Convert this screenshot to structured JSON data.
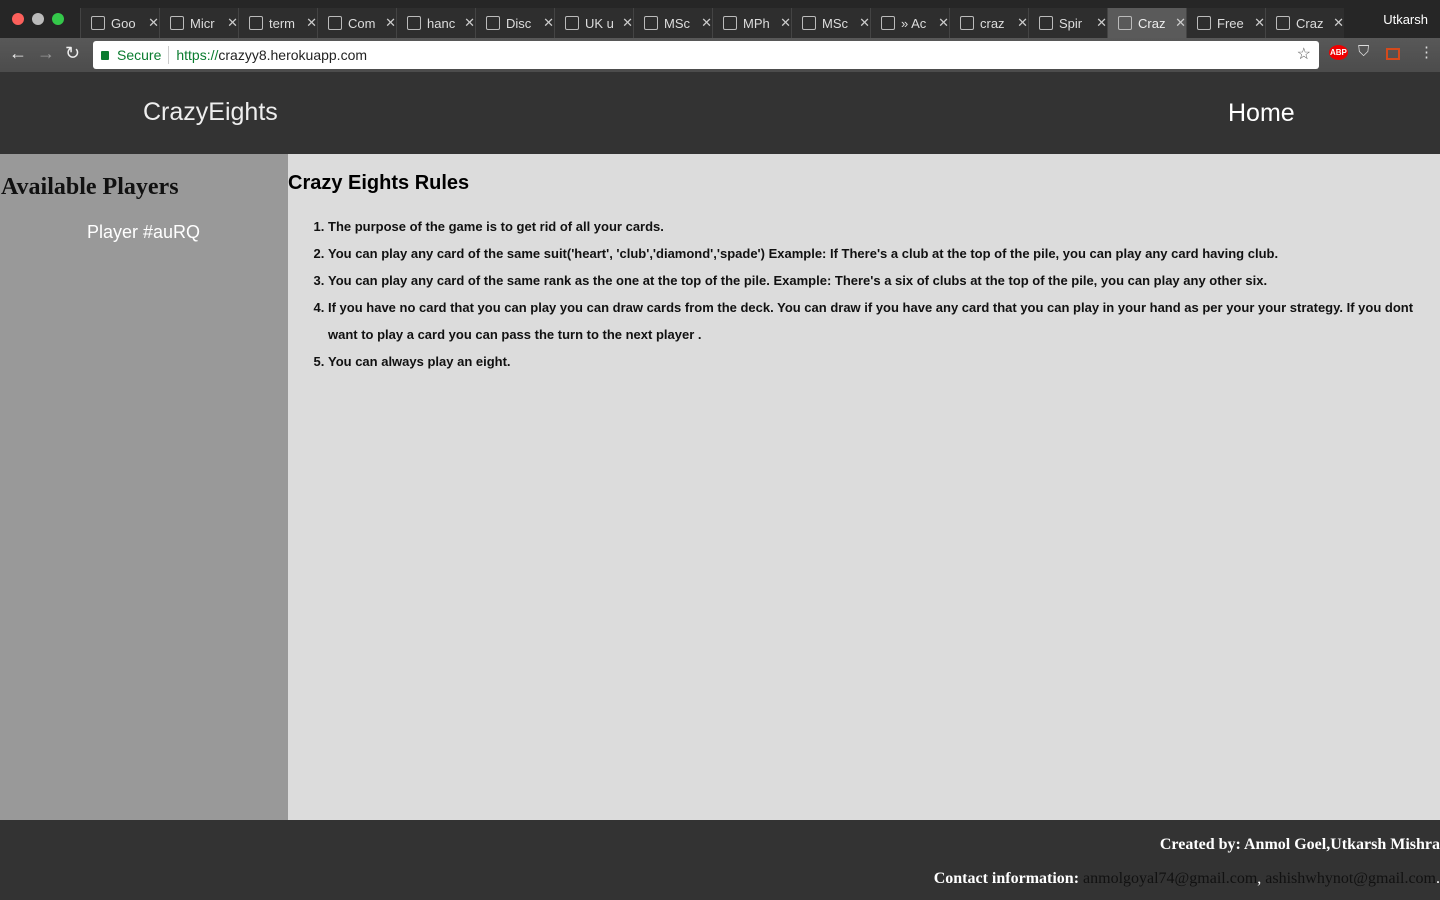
{
  "browser": {
    "tabs": [
      {
        "label": "Goo"
      },
      {
        "label": "Micr"
      },
      {
        "label": "term"
      },
      {
        "label": "Com"
      },
      {
        "label": "hanc"
      },
      {
        "label": "Disc"
      },
      {
        "label": "UK u"
      },
      {
        "label": "MSc"
      },
      {
        "label": "MPh"
      },
      {
        "label": "MSc"
      },
      {
        "label": "» Ac"
      },
      {
        "label": "craz"
      },
      {
        "label": "Spir"
      },
      {
        "label": "Craz",
        "active": true
      },
      {
        "label": "Free"
      },
      {
        "label": "Craz"
      }
    ],
    "profile": "Utkarsh",
    "secure_label": "Secure",
    "url_scheme": "https://",
    "url_host": "crazyy8.herokuapp.com",
    "ext_abp": "ABP"
  },
  "header": {
    "brand": "CrazyEights",
    "home": "Home"
  },
  "sidebar": {
    "title": "Available Players",
    "players": [
      "Player #auRQ"
    ]
  },
  "main": {
    "title": "Crazy Eights Rules",
    "rules": [
      "The purpose of the game is to get rid of all your cards.",
      "You can play any card of the same suit('heart', 'club','diamond','spade') Example: If There's a club at the top of the pile, you can play any card having club.",
      "You can play any card of the same rank as the one at the top of the pile. Example: There's a six of clubs at the top of the pile, you can play any other six.",
      "If you have no card that you can play you can draw cards from the deck. You can draw if you have any card that you can play in your hand as per your your strategy. If you dont want to play a card you can pass the turn to the next player .",
      "You can always play an eight."
    ]
  },
  "footer": {
    "created": "Created by: Anmol Goel,Utkarsh Mishra",
    "contact_label": "Contact information:",
    "email1": "anmolgoyal74@gmail.com",
    "email2": "ashishwhynot@gmail.com",
    "sep": ", ",
    "end": "."
  }
}
